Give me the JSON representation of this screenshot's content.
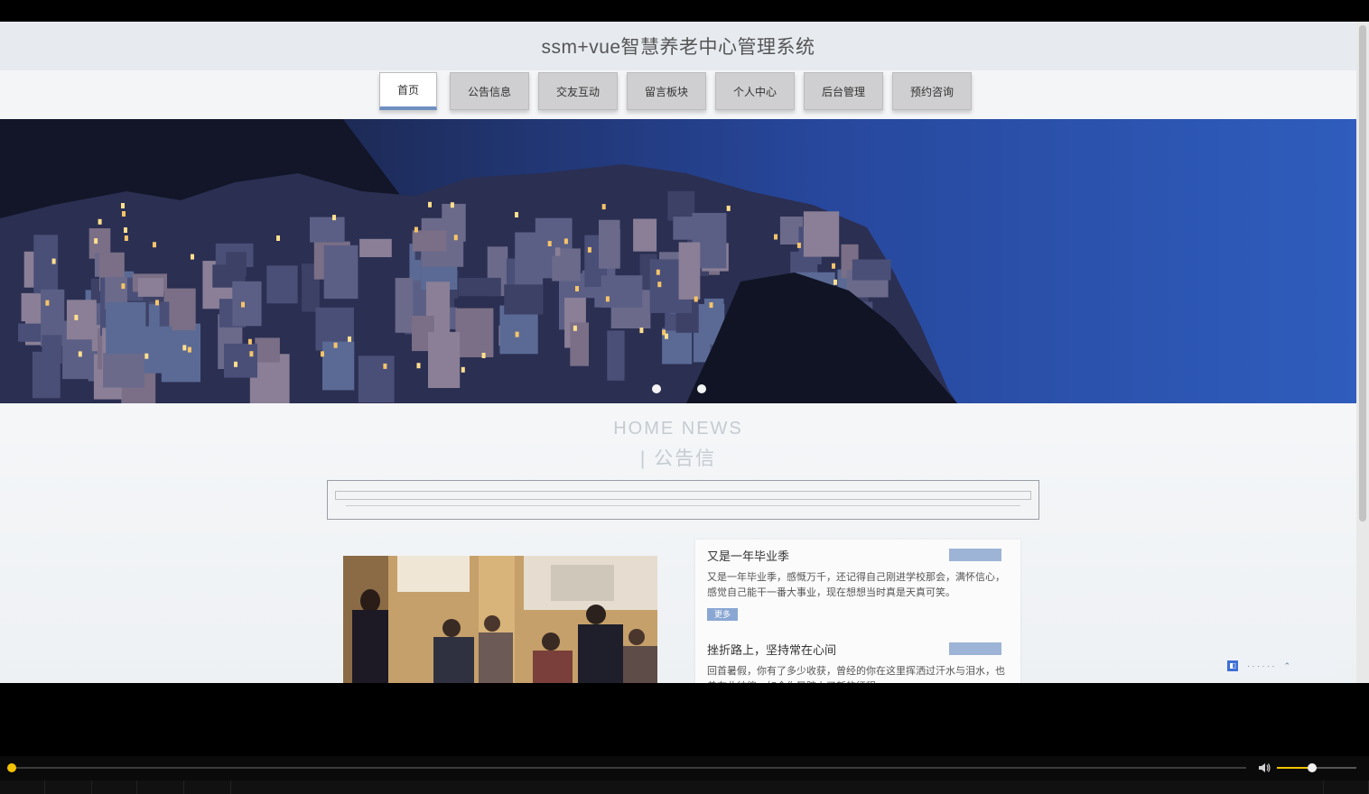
{
  "site": {
    "title": "ssm+vue智慧养老中心管理系统",
    "nav": [
      {
        "label": "首页",
        "active": true
      },
      {
        "label": "公告信息",
        "active": false
      },
      {
        "label": "交友互动",
        "active": false
      },
      {
        "label": "留言板块",
        "active": false
      },
      {
        "label": "个人中心",
        "active": false
      },
      {
        "label": "后台管理",
        "active": false
      },
      {
        "label": "预约咨询",
        "active": false
      }
    ],
    "section": {
      "title_en": "HOME NEWS",
      "title_cn": "| 公告信"
    },
    "news": [
      {
        "title": "又是一年毕业季",
        "desc": "又是一年毕业季，感慨万千，还记得自己刚进学校那会，满怀信心，感觉自己能干一番大事业，现在想想当时真是天真可笑。"
      },
      {
        "title": "挫折路上，坚持常在心间",
        "desc": "回首暑假，你有了多少收获，曾经的你在这里挥洒过汗水与泪水，也曾在此彷徨，如今你又踏上了新的征程。"
      }
    ],
    "more_label": "更多"
  },
  "player": {
    "progress": 0.0,
    "volume": 0.45
  }
}
